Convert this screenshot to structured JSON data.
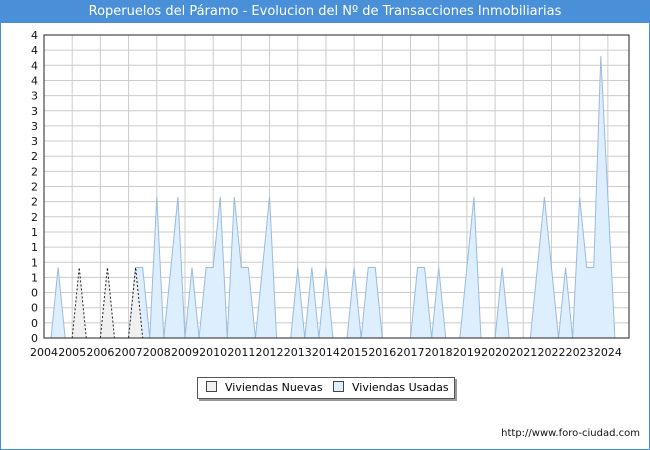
{
  "title": "Roperuelos del Páramo - Evolucion del Nº de Transacciones Inmobiliarias",
  "footer": "http://www.foro-ciudad.com",
  "colors": {
    "accent": "#4a90d9",
    "nuevas_fill": "#f0f0f0",
    "usadas_fill": "#ddeeff",
    "usadas_stroke": "#99bbdd",
    "grid": "#cccccc"
  },
  "chart_data": {
    "type": "area",
    "xlabel": "",
    "ylabel": "",
    "xlim": [
      2004,
      2024.75
    ],
    "ylim": [
      0,
      4.3
    ],
    "x_ticks": [
      "2004",
      "2005",
      "2006",
      "2007",
      "2008",
      "2009",
      "2010",
      "2011",
      "2012",
      "2013",
      "2014",
      "2015",
      "2016",
      "2017",
      "2018",
      "2019",
      "2020",
      "2021",
      "2022",
      "2023",
      "2024"
    ],
    "y_tick_labels": [
      "0",
      "0",
      "0",
      "0",
      "1",
      "1",
      "1",
      "1",
      "2",
      "2",
      "2",
      "2",
      "2",
      "3",
      "3",
      "3",
      "3",
      "4",
      "4",
      "4",
      "4"
    ],
    "legend": {
      "position": "bottom-center",
      "entries": [
        "Viviendas Nuevas",
        "Viviendas Usadas"
      ]
    },
    "grid": true,
    "series": [
      {
        "name": "Viviendas Nuevas",
        "x": [
          2004,
          2004.25,
          2004.5,
          2004.75,
          2005,
          2005.25,
          2005.5,
          2005.75,
          2006,
          2006.25,
          2006.5,
          2006.75,
          2007,
          2007.25,
          2007.5,
          2007.75
        ],
        "y": [
          0,
          0,
          0,
          0,
          0,
          1,
          0,
          0,
          0,
          1,
          0,
          0,
          0,
          1,
          0,
          0
        ]
      },
      {
        "name": "Viviendas Usadas",
        "x": [
          2004,
          2004.25,
          2004.5,
          2004.75,
          2005,
          2005.25,
          2005.5,
          2005.75,
          2006,
          2006.25,
          2006.5,
          2006.75,
          2007,
          2007.25,
          2007.5,
          2007.75,
          2008,
          2008.25,
          2008.5,
          2008.75,
          2009,
          2009.25,
          2009.5,
          2009.75,
          2010,
          2010.25,
          2010.5,
          2010.75,
          2011,
          2011.25,
          2011.5,
          2011.75,
          2012,
          2012.25,
          2012.5,
          2012.75,
          2013,
          2013.25,
          2013.5,
          2013.75,
          2014,
          2014.25,
          2014.5,
          2014.75,
          2015,
          2015.25,
          2015.5,
          2015.75,
          2016,
          2016.25,
          2016.5,
          2016.75,
          2017,
          2017.25,
          2017.5,
          2017.75,
          2018,
          2018.25,
          2018.5,
          2018.75,
          2019,
          2019.25,
          2019.5,
          2019.75,
          2020,
          2020.25,
          2020.5,
          2020.75,
          2021,
          2021.25,
          2021.5,
          2021.75,
          2022,
          2022.25,
          2022.5,
          2022.75,
          2023,
          2023.25,
          2023.5,
          2023.75,
          2024,
          2024.25,
          2024.5,
          2024.75
        ],
        "y": [
          0,
          0,
          1,
          0,
          0,
          0,
          0,
          0,
          0,
          0,
          0,
          0,
          0,
          1,
          1,
          0,
          2,
          0,
          1,
          2,
          0,
          1,
          0,
          1,
          1,
          2,
          0,
          2,
          1,
          1,
          0,
          1,
          2,
          0,
          0,
          0,
          1,
          0,
          1,
          0,
          1,
          0,
          0,
          0,
          1,
          0,
          1,
          1,
          0,
          0,
          0,
          0,
          0,
          1,
          1,
          0,
          1,
          0,
          0,
          0,
          1,
          2,
          0,
          0,
          0,
          1,
          0,
          0,
          0,
          0,
          1,
          2,
          1,
          0,
          1,
          0,
          2,
          1,
          1,
          4,
          2,
          0,
          0,
          0
        ]
      }
    ]
  }
}
